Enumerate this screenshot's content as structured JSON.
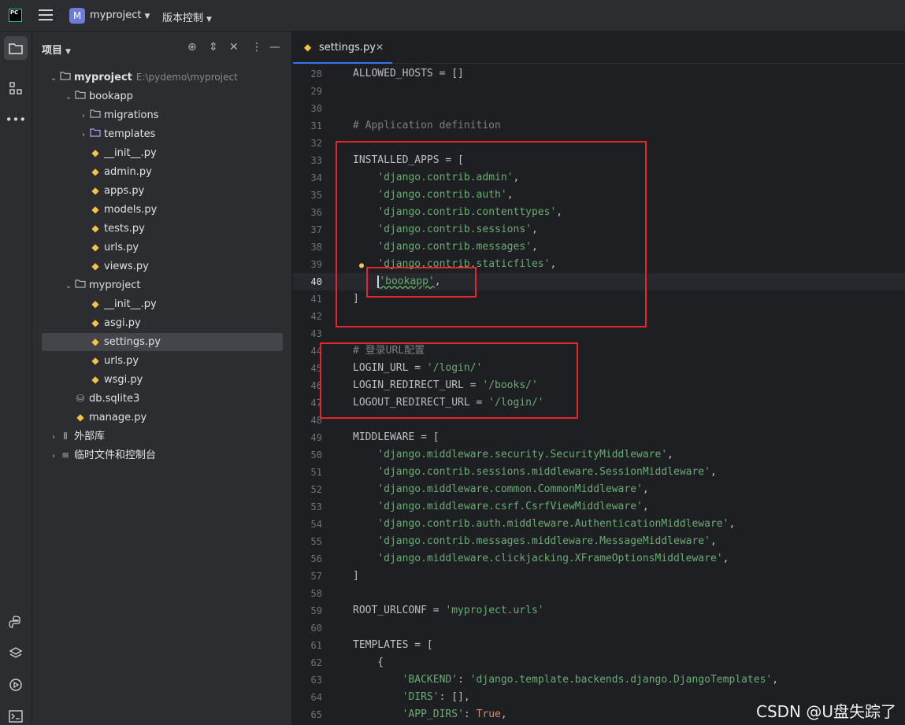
{
  "titlebar": {
    "logo": "PC",
    "project_badge": "M",
    "project_name": "myproject",
    "vcs_label": "版本控制"
  },
  "toolstrip": {
    "top": [
      "folder-icon",
      "structure-icon",
      "more-icon"
    ],
    "bottom": [
      "python-console-icon",
      "layers-icon",
      "services-icon",
      "terminal-icon"
    ]
  },
  "project_panel": {
    "title": "项目",
    "tree": [
      {
        "label": "myproject",
        "path": "E:\\pydemo\\myproject",
        "icon": "folder",
        "depth": 0,
        "expanded": true,
        "bold": true
      },
      {
        "label": "bookapp",
        "icon": "folder",
        "depth": 1,
        "expanded": true
      },
      {
        "label": "migrations",
        "icon": "folder",
        "depth": 2,
        "expanded": false
      },
      {
        "label": "templates",
        "icon": "tfolder",
        "depth": 2,
        "expanded": false
      },
      {
        "label": "__init__.py",
        "icon": "py",
        "depth": 2
      },
      {
        "label": "admin.py",
        "icon": "py",
        "depth": 2
      },
      {
        "label": "apps.py",
        "icon": "py",
        "depth": 2
      },
      {
        "label": "models.py",
        "icon": "py",
        "depth": 2
      },
      {
        "label": "tests.py",
        "icon": "py",
        "depth": 2
      },
      {
        "label": "urls.py",
        "icon": "py",
        "depth": 2
      },
      {
        "label": "views.py",
        "icon": "py",
        "depth": 2
      },
      {
        "label": "myproject",
        "icon": "folder",
        "depth": 1,
        "expanded": true
      },
      {
        "label": "__init__.py",
        "icon": "py",
        "depth": 2
      },
      {
        "label": "asgi.py",
        "icon": "py",
        "depth": 2
      },
      {
        "label": "settings.py",
        "icon": "py",
        "depth": 2,
        "selected": true
      },
      {
        "label": "urls.py",
        "icon": "py",
        "depth": 2
      },
      {
        "label": "wsgi.py",
        "icon": "py",
        "depth": 2
      },
      {
        "label": "db.sqlite3",
        "icon": "db",
        "depth": 1
      },
      {
        "label": "manage.py",
        "icon": "py",
        "depth": 1
      },
      {
        "label": "外部库",
        "icon": "lib",
        "depth": 0,
        "expanded": false
      },
      {
        "label": "临时文件和控制台",
        "icon": "scratch",
        "depth": 0,
        "expanded": false
      }
    ]
  },
  "editor": {
    "tab_label": "settings.py",
    "current_line": 40,
    "lines": [
      {
        "n": "28",
        "text": "ALLOWED_HOSTS = []"
      },
      {
        "n": "29",
        "text": ""
      },
      {
        "n": "30",
        "text": ""
      },
      {
        "n": "31",
        "text": "# Application definition",
        "kind": "comment"
      },
      {
        "n": "32",
        "text": ""
      },
      {
        "n": "33",
        "text": "INSTALLED_APPS = ["
      },
      {
        "n": "34",
        "pre": "    ",
        "str": "'django.contrib.admin'",
        "post": ","
      },
      {
        "n": "35",
        "pre": "    ",
        "str": "'django.contrib.auth'",
        "post": ","
      },
      {
        "n": "36",
        "pre": "    ",
        "str": "'django.contrib.contenttypes'",
        "post": ","
      },
      {
        "n": "37",
        "pre": "    ",
        "str": "'django.contrib.sessions'",
        "post": ","
      },
      {
        "n": "38",
        "pre": "    ",
        "str": "'django.contrib.messages'",
        "post": ","
      },
      {
        "n": "39",
        "pre": "    ",
        "str": "'django.contrib.staticfiles'",
        "post": ",",
        "bulb": true
      },
      {
        "n": "40",
        "pre": "    ",
        "str": "'bookapp'",
        "post": ",",
        "caret": true
      },
      {
        "n": "41",
        "text": "]"
      },
      {
        "n": "42",
        "text": ""
      },
      {
        "n": "43",
        "text": ""
      },
      {
        "n": "44",
        "text": "# 登录URL配置",
        "kind": "comment"
      },
      {
        "n": "45",
        "pre": "LOGIN_URL = ",
        "str": "'/login/'",
        "post": ""
      },
      {
        "n": "46",
        "pre": "LOGIN_REDIRECT_URL = ",
        "str": "'/books/'",
        "post": ""
      },
      {
        "n": "47",
        "pre": "LOGOUT_REDIRECT_URL = ",
        "str": "'/login/'",
        "post": ""
      },
      {
        "n": "48",
        "text": ""
      },
      {
        "n": "49",
        "text": "MIDDLEWARE = ["
      },
      {
        "n": "50",
        "pre": "    ",
        "str": "'django.middleware.security.SecurityMiddleware'",
        "post": ","
      },
      {
        "n": "51",
        "pre": "    ",
        "str": "'django.contrib.sessions.middleware.SessionMiddleware'",
        "post": ","
      },
      {
        "n": "52",
        "pre": "    ",
        "str": "'django.middleware.common.CommonMiddleware'",
        "post": ","
      },
      {
        "n": "53",
        "pre": "    ",
        "str": "'django.middleware.csrf.CsrfViewMiddleware'",
        "post": ","
      },
      {
        "n": "54",
        "pre": "    ",
        "str": "'django.contrib.auth.middleware.AuthenticationMiddleware'",
        "post": ","
      },
      {
        "n": "55",
        "pre": "    ",
        "str": "'django.contrib.messages.middleware.MessageMiddleware'",
        "post": ","
      },
      {
        "n": "56",
        "pre": "    ",
        "str": "'django.middleware.clickjacking.XFrameOptionsMiddleware'",
        "post": ","
      },
      {
        "n": "57",
        "text": "]"
      },
      {
        "n": "58",
        "text": ""
      },
      {
        "n": "59",
        "pre": "ROOT_URLCONF = ",
        "str": "'myproject.urls'",
        "post": ""
      },
      {
        "n": "60",
        "text": ""
      },
      {
        "n": "61",
        "text": "TEMPLATES = ["
      },
      {
        "n": "62",
        "text": "    {"
      },
      {
        "n": "63",
        "pre": "        ",
        "str": "'BACKEND'",
        "mid": ": ",
        "str2": "'django.template.backends.django.DjangoTemplates'",
        "post": ","
      },
      {
        "n": "64",
        "pre": "        ",
        "str": "'DIRS'",
        "post": ": [],"
      },
      {
        "n": "65",
        "pre": "        ",
        "str": "'APP_DIRS'",
        "post": ": ",
        "kw": "True",
        "post2": ","
      }
    ]
  },
  "watermark": "CSDN @U盘失踪了",
  "colors": {
    "accent": "#3574f0",
    "annotation": "#e5262b",
    "string": "#6aab73",
    "comment": "#7a7e85"
  }
}
